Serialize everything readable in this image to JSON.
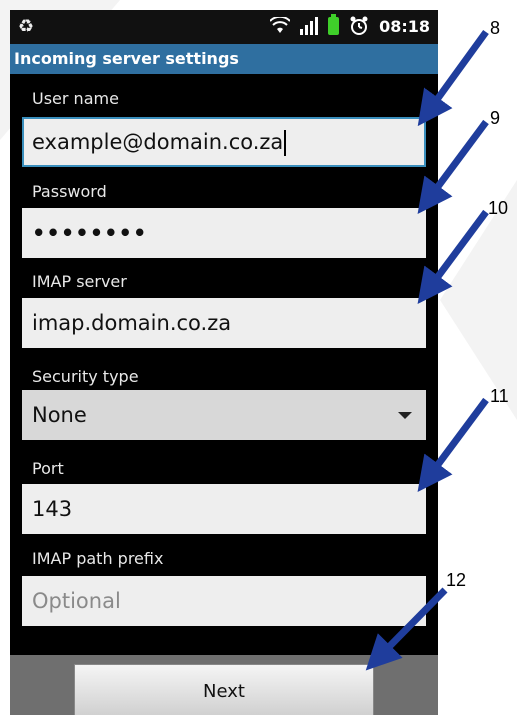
{
  "status": {
    "time": "08:18",
    "left_icon": "recycle-icon"
  },
  "title": "Incoming server settings",
  "fields": [
    {
      "label": "User name",
      "value": "example@domain.co.za"
    },
    {
      "label": "Password",
      "value": "••••••••"
    },
    {
      "label": "IMAP server",
      "value": "imap.domain.co.za"
    },
    {
      "label": "Security type",
      "value": "None"
    },
    {
      "label": "Port",
      "value": "143"
    },
    {
      "label": "IMAP path prefix",
      "placeholder": "Optional"
    }
  ],
  "next_label": "Next",
  "annotations": [
    "8",
    "9",
    "10",
    "11",
    "12"
  ],
  "colors": {
    "title_bar": "#2f6fa0",
    "arrow": "#1f3d9c",
    "focus_border": "#3a8fbd"
  }
}
